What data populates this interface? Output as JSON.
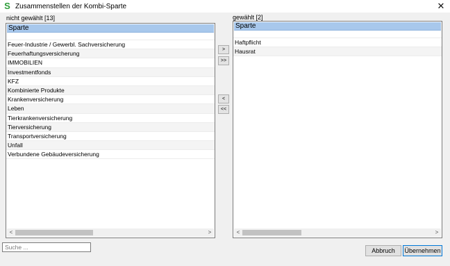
{
  "window": {
    "title": "Zusammenstellen der Kombi-Sparte",
    "icon_letter": "S",
    "close_glyph": "✕"
  },
  "left": {
    "label": "nicht gewählt [13]",
    "header": "Sparte",
    "items": [
      "Feuer-Industrie / Gewerbl. Sachversicherung",
      "Feuerhaftungsversicherung",
      "IMMOBILIEN",
      "Investmentfonds",
      "KFZ",
      "Kombinierte Produkte",
      "Krankenversicherung",
      "Leben",
      "Tierkrankenversicherung",
      "Tierversicherung",
      "Transportversicherung",
      "Unfall",
      "Verbundene Gebäudeversicherung"
    ]
  },
  "right": {
    "label": "gewählt [2]",
    "header": "Sparte",
    "items": [
      "Haftpflicht",
      "Hausrat"
    ]
  },
  "move_buttons": {
    "add_one": ">",
    "add_all": ">>",
    "remove_one": "<",
    "remove_all": "<<"
  },
  "scrollbar": {
    "left_arrow": "<",
    "right_arrow": ">"
  },
  "search": {
    "placeholder": "Suche ...",
    "value": ""
  },
  "buttons": {
    "cancel": "Abbruch",
    "apply": "Übernehmen"
  },
  "colors": {
    "selection_header": "#a8c8ec",
    "icon_green": "#2e9e3a",
    "default_border": "#0078d7"
  }
}
